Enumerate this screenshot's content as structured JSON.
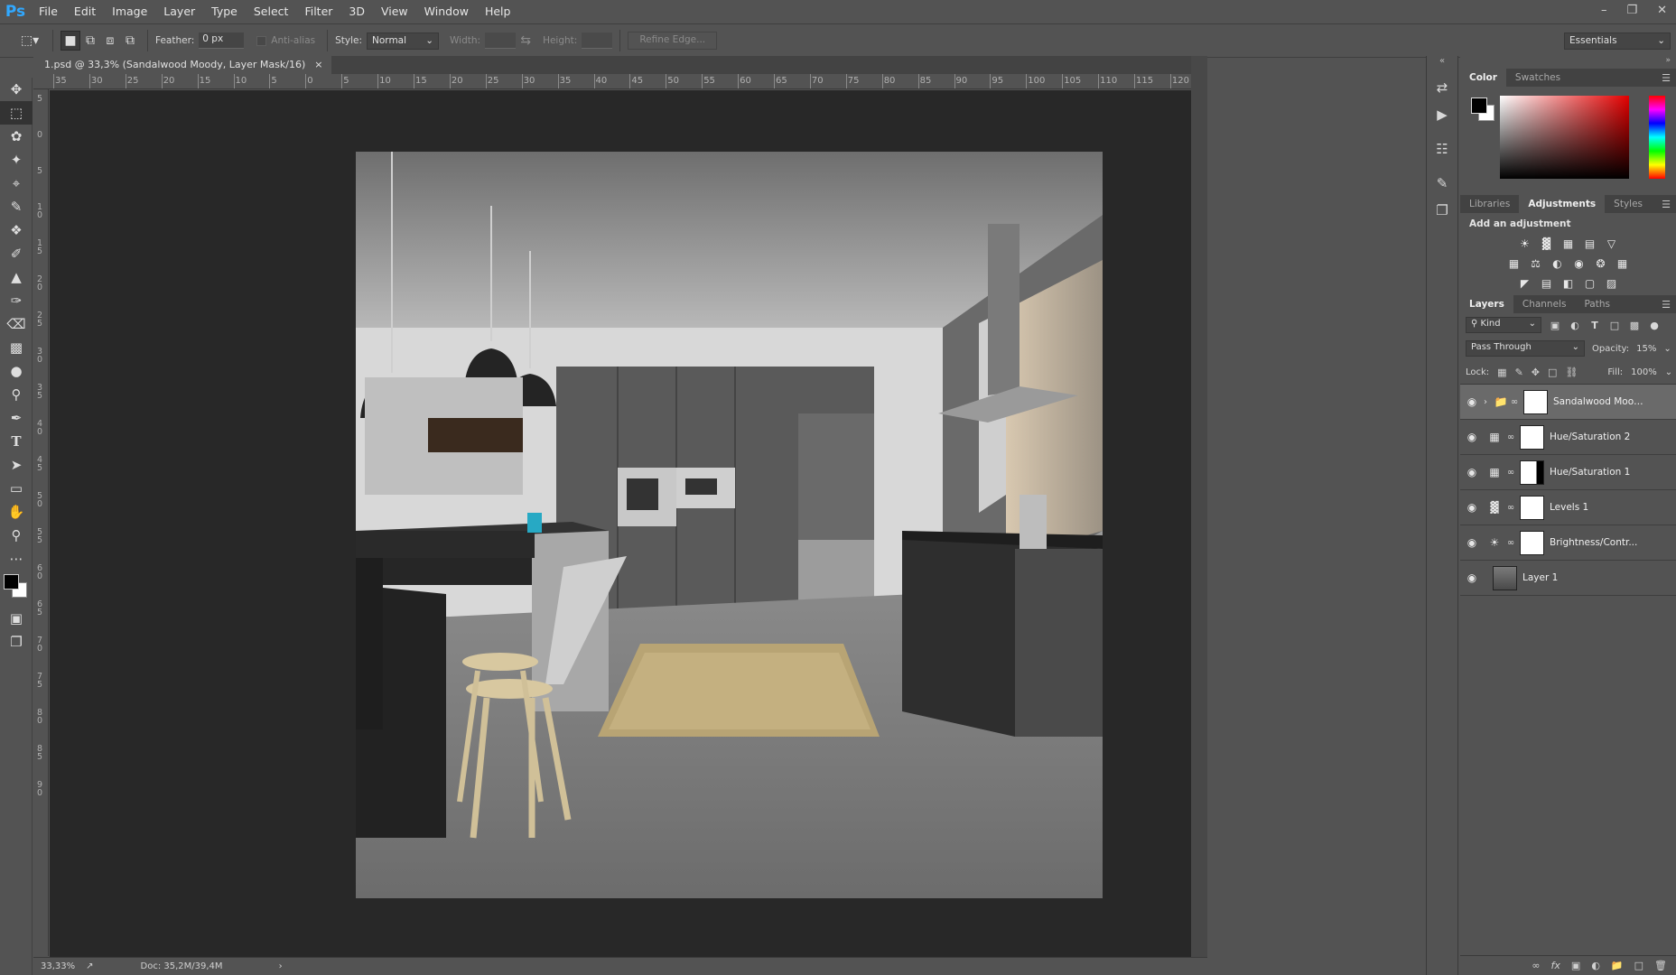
{
  "app": {
    "logo": "Ps"
  },
  "menu": [
    "File",
    "Edit",
    "Image",
    "Layer",
    "Type",
    "Select",
    "Filter",
    "3D",
    "View",
    "Window",
    "Help"
  ],
  "options": {
    "feather_label": "Feather:",
    "feather_value": "0 px",
    "antialias_label": "Anti-alias",
    "style_label": "Style:",
    "style_value": "Normal",
    "width_label": "Width:",
    "height_label": "Height:",
    "refine_label": "Refine Edge...",
    "workspace": "Essentials"
  },
  "document": {
    "tab_title": "1.psd @ 33,3% (Sandalwood Moody, Layer Mask/16)",
    "zoom": "33,33%",
    "doc_size": "Doc: 35,2M/39,4M"
  },
  "ruler_h": [
    "35",
    "30",
    "25",
    "20",
    "15",
    "10",
    "5",
    "0",
    "5",
    "10",
    "15",
    "20",
    "25",
    "30",
    "35",
    "40",
    "45",
    "50",
    "55",
    "60",
    "65",
    "70",
    "75",
    "80",
    "85",
    "90",
    "95",
    "100",
    "105",
    "110",
    "115",
    "120"
  ],
  "ruler_v": [
    "5",
    "0",
    "5",
    "10",
    "15",
    "20",
    "25",
    "30",
    "35",
    "40",
    "45",
    "50",
    "55",
    "60",
    "65",
    "70",
    "75",
    "80",
    "85",
    "90"
  ],
  "color_panel": {
    "tabs": [
      "Color",
      "Swatches"
    ],
    "active": "Color"
  },
  "adjustments_panel": {
    "tabs": [
      "Libraries",
      "Adjustments",
      "Styles"
    ],
    "active": "Adjustments",
    "title": "Add an adjustment"
  },
  "layers_panel": {
    "tabs": [
      "Layers",
      "Channels",
      "Paths"
    ],
    "active": "Layers",
    "filter_kind": "Kind",
    "blend_mode": "Pass Through",
    "opacity_label": "Opacity:",
    "opacity_value": "15%",
    "lock_label": "Lock:",
    "fill_label": "Fill:",
    "fill_value": "100%",
    "layers": [
      {
        "name": "Sandalwood Moody",
        "kind": "group",
        "selected": true
      },
      {
        "name": "Hue/Saturation 2",
        "kind": "adjustment"
      },
      {
        "name": "Hue/Saturation 1",
        "kind": "adjustment"
      },
      {
        "name": "Levels 1",
        "kind": "levels"
      },
      {
        "name": "Brightness/Contr...",
        "kind": "brightness"
      },
      {
        "name": "Layer 1",
        "kind": "pixel"
      }
    ]
  }
}
